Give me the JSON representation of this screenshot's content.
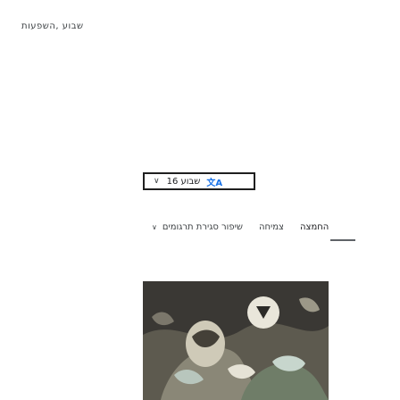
{
  "header": {
    "text": "שבוע ,השפעות"
  },
  "range_selector": {
    "label": "שבוע 16",
    "icon": "translate-icon"
  },
  "tabs": [
    {
      "label": "שיפור סגירת תרגומים"
    },
    {
      "label": "צמיחה"
    },
    {
      "label": "החמצה"
    }
  ],
  "image": {
    "icon": "figure-illustration"
  }
}
